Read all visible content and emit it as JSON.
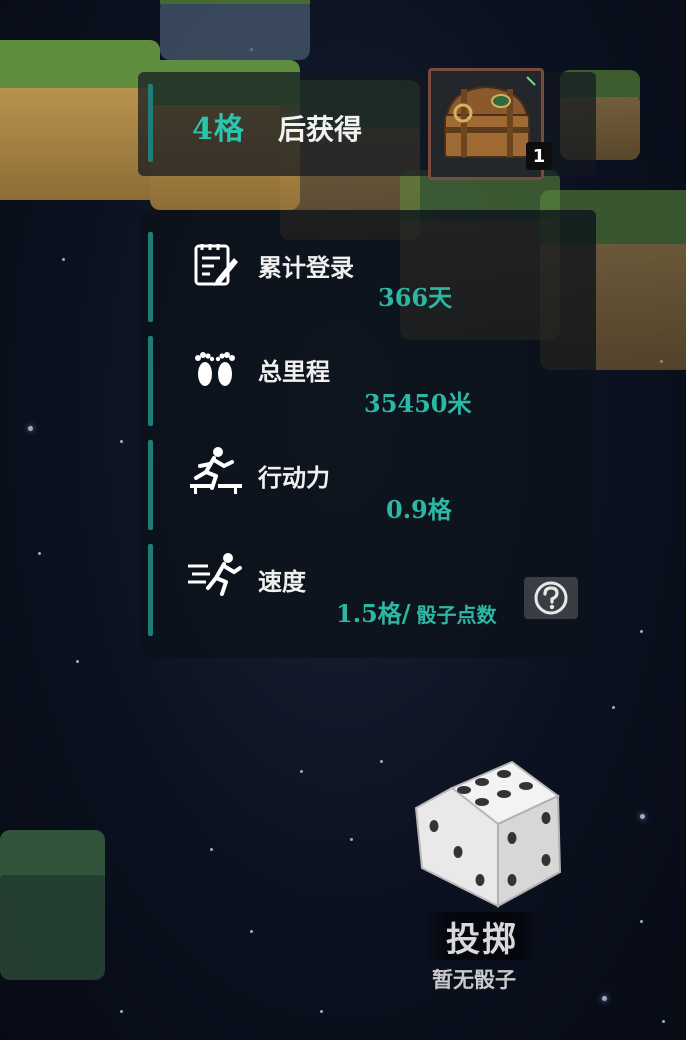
{
  "reward": {
    "count": "4格",
    "text": "后获得",
    "chest_icon": "treasure-chest-icon",
    "quantity": "1"
  },
  "stats": {
    "login": {
      "label": "累计登录",
      "value": "366天",
      "icon": "notepad-pencil-icon"
    },
    "distance": {
      "label": "总里程",
      "value": "35450米",
      "icon": "footprints-icon"
    },
    "action": {
      "label": "行动力",
      "value": "0.9格",
      "icon": "runner-hurdle-icon"
    },
    "speed": {
      "label": "速度",
      "value": "1.5格/",
      "value_suffix": "骰子点数",
      "icon": "running-fast-icon",
      "help_icon": "question-circle-icon"
    }
  },
  "dice": {
    "roll_label": "投掷",
    "status": "暂无骰子",
    "icon": "dice-icon"
  },
  "colors": {
    "accent": "#2cc4ad",
    "panel": "#0c121a",
    "divider": "#1f7f78"
  }
}
